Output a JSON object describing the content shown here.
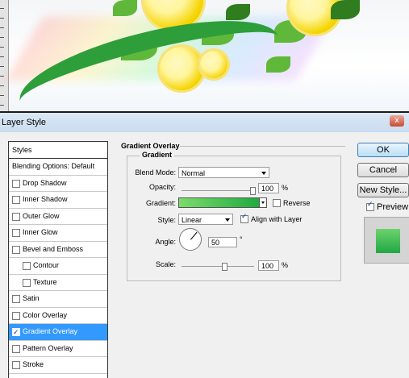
{
  "dialog": {
    "title": "Layer Style",
    "close": "x"
  },
  "styles_panel": {
    "header": "Styles",
    "items": [
      {
        "label": "Blending Options: Default"
      },
      {
        "label": "Drop Shadow",
        "checked": false
      },
      {
        "label": "Inner Shadow",
        "checked": false
      },
      {
        "label": "Outer Glow",
        "checked": false
      },
      {
        "label": "Inner Glow",
        "checked": false
      },
      {
        "label": "Bevel and Emboss",
        "checked": false
      },
      {
        "label": "Contour",
        "checked": false
      },
      {
        "label": "Texture",
        "checked": false
      },
      {
        "label": "Satin",
        "checked": false
      },
      {
        "label": "Color Overlay",
        "checked": false
      },
      {
        "label": "Gradient Overlay",
        "checked": true,
        "selected": true
      },
      {
        "label": "Pattern Overlay",
        "checked": false
      },
      {
        "label": "Stroke",
        "checked": false
      }
    ]
  },
  "gradient_overlay": {
    "section_title": "Gradient Overlay",
    "group_title": "Gradient",
    "blend_mode_label": "Blend Mode:",
    "blend_mode": "Normal",
    "opacity_label": "Opacity:",
    "opacity": "100",
    "opacity_unit": "%",
    "gradient_label": "Gradient:",
    "gradient_colors": [
      "#7bdc6b",
      "#1eab3f"
    ],
    "reverse_label": "Reverse",
    "reverse_checked": false,
    "style_label": "Style:",
    "style": "Linear",
    "align_label": "Align with Layer",
    "align_checked": true,
    "angle_label": "Angle:",
    "angle": "50",
    "angle_unit": "°",
    "scale_label": "Scale:",
    "scale": "100",
    "scale_unit": "%"
  },
  "buttons": {
    "ok": "OK",
    "cancel": "Cancel",
    "new_style": "New Style..."
  },
  "preview": {
    "label": "Preview",
    "checked": true
  }
}
